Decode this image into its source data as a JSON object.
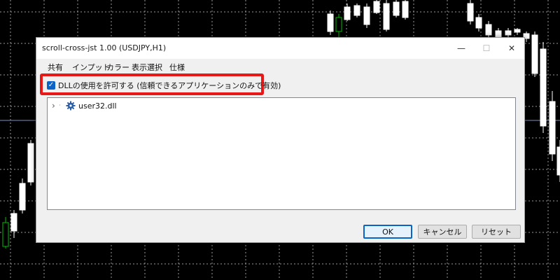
{
  "window": {
    "title": "scroll-cross-jst 1.00 (USDJPY,H1)",
    "minimize_glyph": "—",
    "maximize_glyph": "☐",
    "close_glyph": "✕"
  },
  "menu": {
    "items": [
      "共有",
      "インプット",
      "カラー",
      "表示選択",
      "仕様"
    ]
  },
  "dll_option": {
    "checked": true,
    "label": "DLLの使用を許可する (信頼できるアプリケーションのみで有効)"
  },
  "tree": {
    "items": [
      {
        "label": "user32.dll",
        "icon": "gear-icon",
        "expander": "›"
      }
    ]
  },
  "buttons": {
    "ok": "OK",
    "cancel": "キャンセル",
    "reset": "リセット"
  },
  "colors": {
    "accent": "#0a64c8",
    "highlight": "#e81818",
    "chart_bg": "#000000",
    "candle": "#ffffff",
    "up_candle": "#00c000"
  }
}
